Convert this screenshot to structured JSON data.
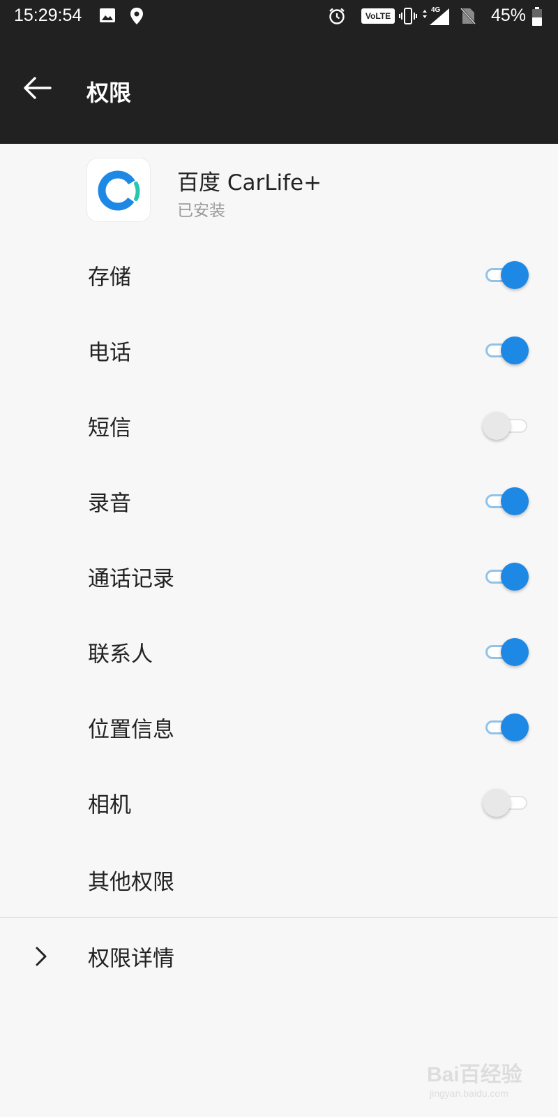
{
  "status_bar": {
    "time": "15:29:54",
    "volte": "VoLTE",
    "network": "4G",
    "battery": "45%",
    "icons": [
      "image-icon",
      "location-icon",
      "alarm-icon",
      "volte-icon",
      "vibrate-icon",
      "signal-icon",
      "no-sim-icon",
      "battery-icon"
    ]
  },
  "toolbar": {
    "title": "权限",
    "back_icon": "back-arrow-icon"
  },
  "app": {
    "name": "百度 CarLife+",
    "status": "已安装",
    "icon": "carlife-app-icon",
    "icon_colors": [
      "#1e88e5",
      "#26c6b0"
    ]
  },
  "permissions": [
    {
      "label": "存储",
      "enabled": true
    },
    {
      "label": "电话",
      "enabled": true
    },
    {
      "label": "短信",
      "enabled": false
    },
    {
      "label": "录音",
      "enabled": true
    },
    {
      "label": "通话记录",
      "enabled": true
    },
    {
      "label": "联系人",
      "enabled": true
    },
    {
      "label": "位置信息",
      "enabled": true
    },
    {
      "label": "相机",
      "enabled": false
    }
  ],
  "other_permissions": {
    "label": "其他权限"
  },
  "details": {
    "label": "权限详情",
    "icon": "chevron-right-icon"
  },
  "watermark": {
    "text": "Bai百经验",
    "sub": "jingyan.baidu.com"
  },
  "colors": {
    "accent": "#1e88e5",
    "toolbar_bg": "#212121",
    "page_bg": "#f7f7f7"
  }
}
